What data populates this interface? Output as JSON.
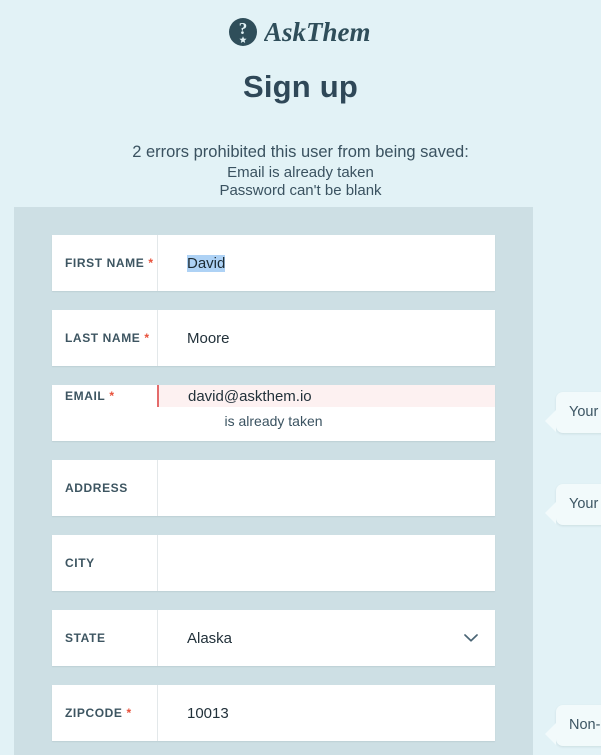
{
  "brand": {
    "name": "AskThem",
    "badge_icon": "question-mark-star-badge-icon",
    "logo_color": "#2f4e5a"
  },
  "header": {
    "title": "Sign up"
  },
  "errors": {
    "summary": "2 errors prohibited this user from being saved:",
    "items": [
      "Email is already taken",
      "Password can't be blank"
    ],
    "count": 2
  },
  "colors": {
    "page_background": "#e2f2f6",
    "panel_background": "#cddfe4",
    "label_text": "#3d5561",
    "required_asterisk": "#e8503a",
    "error_field_background": "#fdf1f1",
    "error_field_border": "#e46b6b",
    "selection_highlight": "#aed2f5",
    "tip_background": "#f2fafb"
  },
  "form": {
    "fields": [
      {
        "name": "first-name",
        "label": "FIRST NAME",
        "required": true,
        "value": "David",
        "selected": true,
        "error": null
      },
      {
        "name": "last-name",
        "label": "LAST NAME",
        "required": true,
        "value": "Moore",
        "selected": false,
        "error": null
      },
      {
        "name": "email",
        "label": "EMAIL",
        "required": true,
        "value": "david@askthem.io",
        "selected": false,
        "error": "is already taken"
      },
      {
        "name": "address",
        "label": "ADDRESS",
        "required": false,
        "value": "",
        "selected": false,
        "error": null
      },
      {
        "name": "city",
        "label": "CITY",
        "required": false,
        "value": "",
        "selected": false,
        "error": null
      },
      {
        "name": "state",
        "label": "STATE",
        "required": false,
        "value": "Alaska",
        "selected": false,
        "error": null,
        "control": "select",
        "icon": "chevron-down-icon"
      },
      {
        "name": "zipcode",
        "label": "ZIPCODE",
        "required": true,
        "value": "10013",
        "selected": false,
        "error": null
      }
    ],
    "required_marker": "*"
  },
  "tips": [
    {
      "name": "email-tip",
      "text": "Your e remai"
    },
    {
      "name": "address-tip",
      "text": "Your a remai well!"
    },
    {
      "name": "zipcode-tip",
      "text": "Non-U pleas"
    }
  ]
}
